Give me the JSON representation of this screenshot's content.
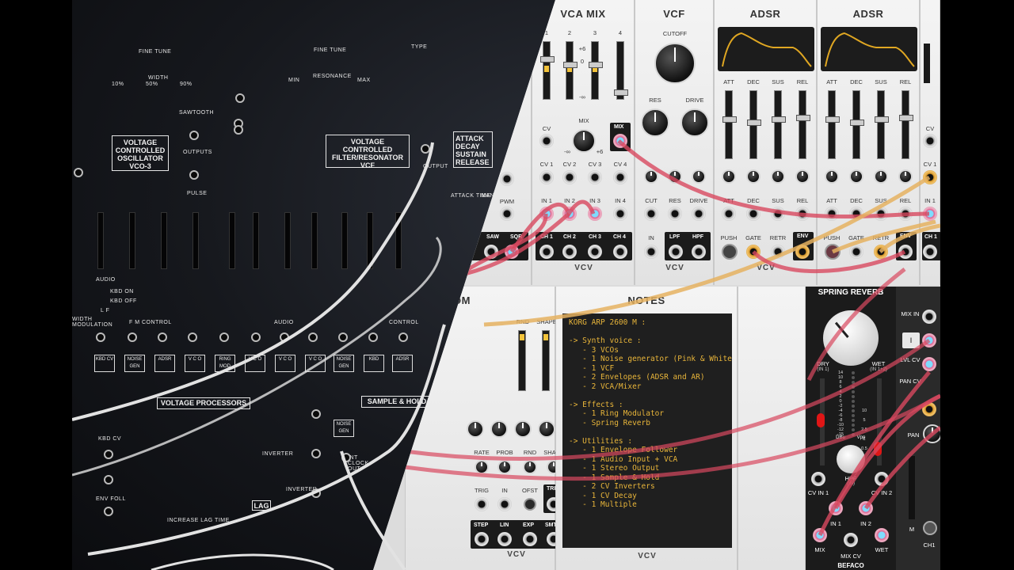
{
  "arp": {
    "labels": {
      "fine_tune": "FINE TUNE",
      "fine_tune2": "FINE TUNE",
      "width": "WIDTH",
      "width_50": "50%",
      "width_90": "90%",
      "width_10": "10%",
      "type": "TYPE",
      "sawtooth": "SAWTOOTH",
      "outputs": "OUTPUTS",
      "pulse": "PULSE",
      "resonance": "RESONANCE",
      "min": "MIN",
      "max": "MAX",
      "audio": "AUDIO",
      "kbd_on": "KBD ON",
      "kbd_off": "KBD OFF",
      "lf": "L F",
      "fm_control": "F M  CONTROL",
      "audio2": "AUDIO",
      "control": "CONTROL",
      "width_mod": "WIDTH MODULATION",
      "attack_time": "ATTACK TIME",
      "manual_start": "MANUAL START",
      "output": "OUTPUT",
      "inverter": "INVERTER",
      "inverter2": "INVERTER",
      "lag": "LAG",
      "increase_lag": "INCREASE LAG TIME",
      "kbd_cv": "KBD CV",
      "env_foll": "ENV FOLL",
      "int_clock_out": "INT CLOCK OUT"
    },
    "boxes": {
      "vco": "VOLTAGE CONTROLLED OSCILLATOR VCO-3",
      "vcf": "VOLTAGE CONTROLLED FILTER/RESONATOR VCF",
      "adsr": "ATTACK DECAY SUSTAIN RELEASE",
      "voltage_processors": "VOLTAGE PROCESSORS",
      "sample_hold": "SAMPLE & HOLD"
    },
    "tags": [
      "KBD CV",
      "NOISE GEN",
      "ADSR",
      "V C O",
      "RING MOD",
      "V C O",
      "V C O",
      "V C O",
      "NOISE GEN",
      "KBD",
      "ADSR"
    ],
    "noise_gen": "NOISE GEN"
  },
  "vca_mix": {
    "title": "VCA MIX",
    "channels": [
      "1",
      "2",
      "3",
      "4"
    ],
    "scale": [
      "+6",
      "0",
      "-∞"
    ],
    "mix": "MIX",
    "mix_out": "MIX",
    "cv": "CV",
    "mix_range": [
      "-∞",
      "+6"
    ],
    "cv_labels": [
      "CV 1",
      "CV 2",
      "CV 3",
      "CV 4"
    ],
    "in_labels": [
      "IN 1",
      "IN 2",
      "IN 3",
      "IN 4"
    ],
    "ch_labels": [
      "CH 1",
      "CH 2",
      "CH 3",
      "CH 4"
    ],
    "brand": "VCV"
  },
  "vco_partial": {
    "labels": [
      "CV",
      "PWM"
    ],
    "outs": [
      "SAW",
      "SQR"
    ]
  },
  "vcf": {
    "title": "VCF",
    "cutoff": "CUTOFF",
    "res": "RES",
    "drive": "DRIVE",
    "ins": [
      "CUT",
      "RES",
      "DRIVE"
    ],
    "in": "IN",
    "outs": [
      "LPF",
      "HPF"
    ],
    "brand": "VCV"
  },
  "adsr1": {
    "title": "ADSR",
    "params": [
      "ATT",
      "DEC",
      "SUS",
      "REL"
    ],
    "bottom": [
      "PUSH",
      "GATE",
      "RETR",
      "ENV"
    ],
    "brand": "VCV"
  },
  "adsr2": {
    "title": "ADSR",
    "params": [
      "ATT",
      "DEC",
      "SUS",
      "REL"
    ],
    "bottom": [
      "PUSH",
      "GATE",
      "RETR",
      "ENV"
    ]
  },
  "vco_right": {
    "label": "CV 1",
    "in": "IN 1",
    "ch": "CH 1",
    "cv": "CV"
  },
  "random": {
    "title_fragment": "OM",
    "labels": [
      "RND",
      "SHAPE"
    ],
    "knob_row": [
      "RATE",
      "PROB",
      "RND",
      "SHAPE"
    ],
    "jacks": [
      "TRIG",
      "IN",
      "OFST",
      "TRIG"
    ],
    "outs": [
      "STEP",
      "LIN",
      "EXP",
      "SMTH"
    ],
    "brand": "VCV"
  },
  "notes": {
    "title": "NOTES",
    "text": "KORG ARP 2600 M :\n\n-> Synth voice :\n   - 3 VCOs\n   - 1 Noise generator (Pink & White)\n   - 1 VCF\n   - 2 Envelopes (ADSR and AR)\n   - 2 VCA/Mixer\n\n-> Effects :\n   - 1 Ring Modulator\n   - Spring Reverb\n\n-> Utilities :\n   - 1 Envelope Follower\n   - 1 Audio Input + VCA\n   - 1 Stereo Output\n   - 1 Sample & Hold\n   - 2 CV Inverters\n   - 1 CV Decay\n   - 1 Multiple",
    "brand": "VCV"
  },
  "reverb": {
    "title": "SPRING REVERB",
    "dry": "DRY",
    "dry_sub": "(IN 1)",
    "wet": "WET",
    "wet_sub": "(IN 1+2)",
    "scale": [
      "14",
      "10",
      "8",
      "6",
      "4",
      "2",
      "0",
      "-2",
      "-4",
      "-6",
      "-8",
      "-10",
      "-12",
      "-15"
    ],
    "dbu": "DBu",
    "vpp": "Vpp",
    "vpp_vals": [
      "10",
      "5",
      "2.5",
      "1",
      "0.5"
    ],
    "hpf": "HPF",
    "hpf_sub": "(IN)",
    "cv_in1": "CV IN 1",
    "cv_in2": "CV IN 2",
    "in1": "IN 1",
    "in2": "IN 2",
    "mix": "MIX",
    "mix_cv": "MIX CV",
    "wet_out": "WET",
    "brand": "BEFACO"
  },
  "mixer": {
    "mix_in": "MIX IN",
    "lvl_cv": "LVL CV",
    "pan_cv": "PAN CV",
    "pan": "PAN",
    "m": "M",
    "ch1": "CH1",
    "one": "I"
  }
}
